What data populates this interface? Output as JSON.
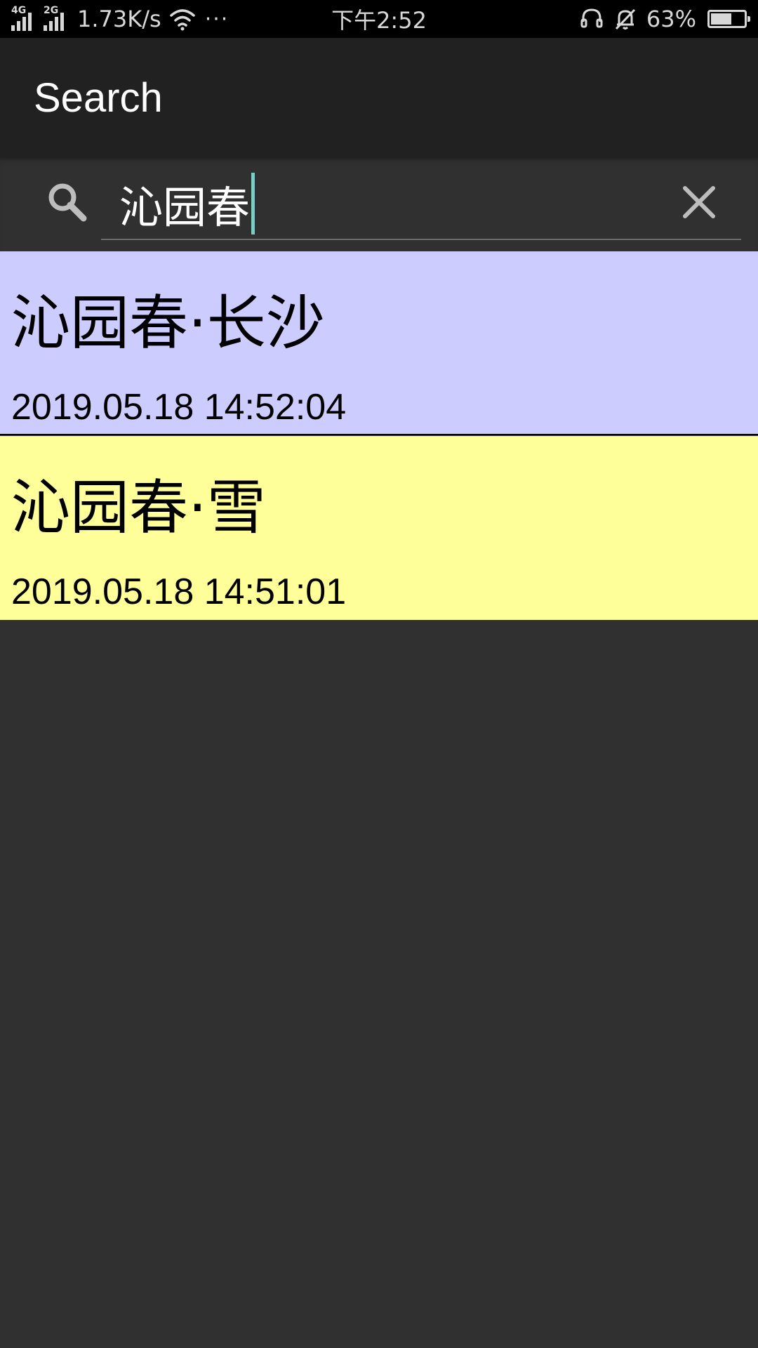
{
  "status_bar": {
    "network_1": "4G",
    "network_2": "2G",
    "speed": "1.73K/s",
    "more": "···",
    "time": "下午2:52",
    "battery_percent": "63%",
    "battery_level": 0.63,
    "icons": [
      "signal-icon",
      "wifi-icon",
      "headset-icon",
      "bell-muted-icon",
      "battery-icon"
    ]
  },
  "app_bar": {
    "title": "Search"
  },
  "search": {
    "icon": "search-icon",
    "query": "沁园春",
    "clear_icon": "close-icon",
    "accent_color": "#80cbc4"
  },
  "results": [
    {
      "title": "沁园春·长沙",
      "date": "2019.05.18 14:52:04",
      "color": "#ccccff"
    },
    {
      "title": "沁园春·雪",
      "date": "2019.05.18 14:51:01",
      "color": "#ffff99"
    }
  ]
}
